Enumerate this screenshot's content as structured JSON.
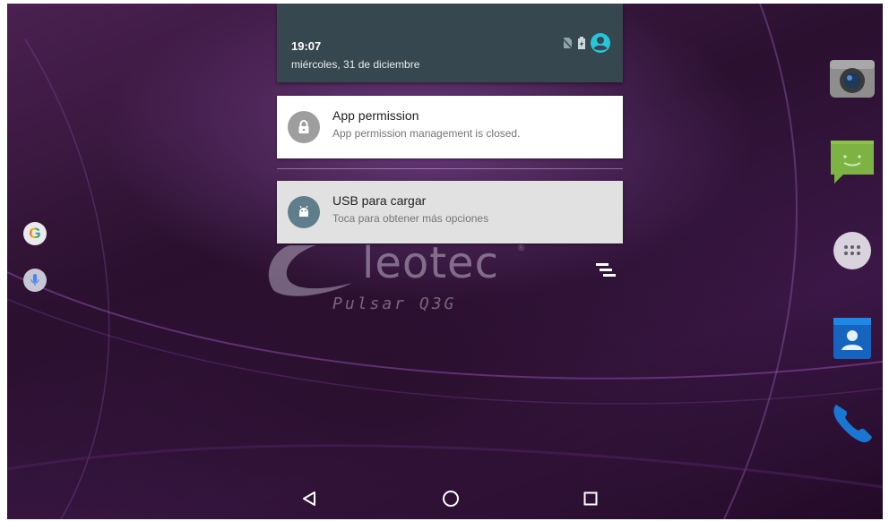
{
  "status_bar": {
    "time": "19:07",
    "date": "miércoles, 31 de diciembre",
    "icons": [
      "no-sim-icon",
      "battery-charging-icon",
      "user-account-icon"
    ]
  },
  "notifications": [
    {
      "icon": "lock-icon",
      "title": "App permission",
      "body": "App permission management is closed.",
      "badge_color": "#9e9e9e"
    },
    {
      "icon": "android-icon",
      "title": "USB para cargar",
      "body": "Toca para obtener más opciones",
      "badge_color": "#607d8b"
    }
  ],
  "wallpaper": {
    "brand": "leotec",
    "brand_mark": "®",
    "model": "Pulsar Q3G"
  },
  "search": {
    "google_label": "G",
    "icons": [
      "google-icon",
      "mic-icon"
    ]
  },
  "dock": [
    "camera-icon",
    "messaging-icon",
    "app-drawer-icon",
    "contacts-icon",
    "phone-icon"
  ],
  "navigation": [
    "back-icon",
    "home-icon",
    "recents-icon"
  ],
  "colors": {
    "shade_header": "#37474f",
    "accent": "#26c6da"
  }
}
